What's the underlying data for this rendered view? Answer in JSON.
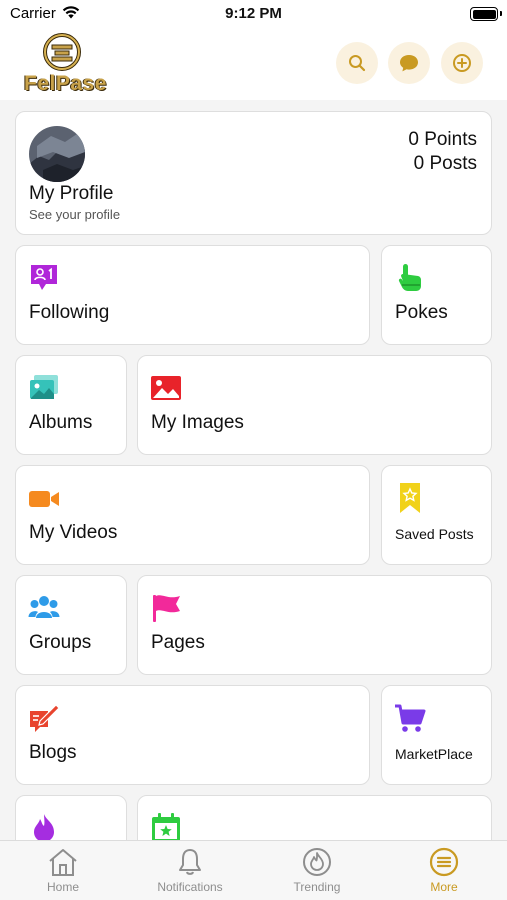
{
  "status_bar": {
    "carrier": "Carrier",
    "time": "9:12 PM"
  },
  "app": {
    "logo_text": "FelPase"
  },
  "header_actions": [
    {
      "icon": "search-icon"
    },
    {
      "icon": "chat-icon"
    },
    {
      "icon": "add-circle-icon"
    }
  ],
  "profile": {
    "name": "My Profile",
    "subtitle": "See your profile",
    "points": "0 Points",
    "posts": "0 Posts"
  },
  "menu": {
    "following": "Following",
    "pokes": "Pokes",
    "albums": "Albums",
    "my_images": "My Images",
    "my_videos": "My Videos",
    "saved_posts": "Saved Posts",
    "groups": "Groups",
    "pages": "Pages",
    "blogs": "Blogs",
    "marketplace": "MarketPlace"
  },
  "colors": {
    "accent": "#c99a22",
    "header_button_bg": "#faf1df",
    "following": "#b026d9",
    "pokes": "#2ecc40",
    "albums": "#35c2b9",
    "my_images": "#e8232a",
    "my_videos": "#f58a1f",
    "saved_posts": "#f1d21a",
    "groups": "#2e9be8",
    "pages": "#f2299a",
    "blogs": "#e8442e",
    "marketplace": "#7a3be8"
  },
  "tabs": [
    {
      "label": "Home",
      "icon": "home-icon",
      "active": false
    },
    {
      "label": "Notifications",
      "icon": "bell-icon",
      "active": false
    },
    {
      "label": "Trending",
      "icon": "flame-icon",
      "active": false
    },
    {
      "label": "More",
      "icon": "menu-circle-icon",
      "active": true
    }
  ]
}
